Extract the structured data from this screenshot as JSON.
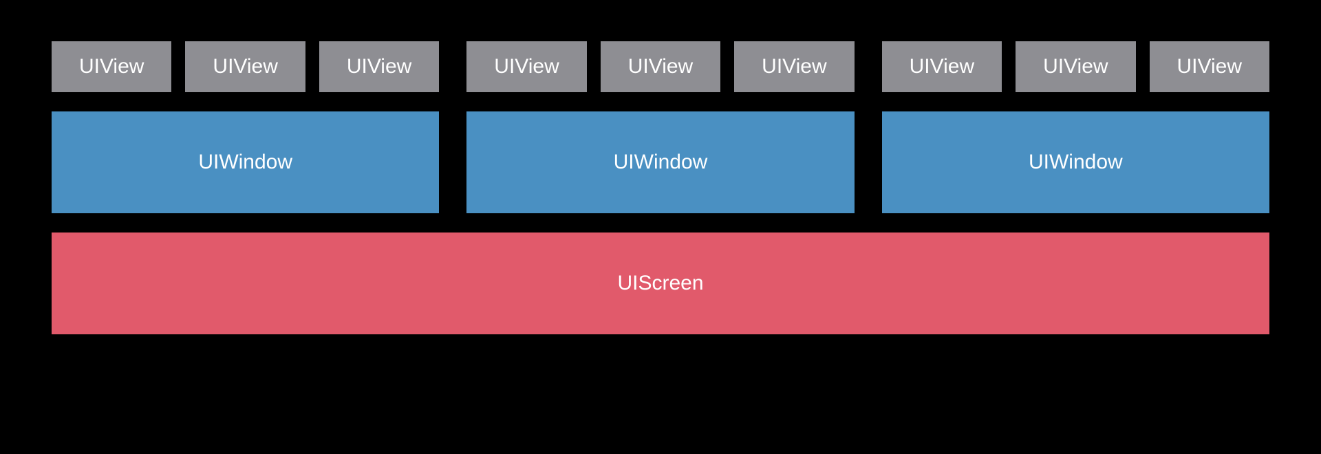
{
  "hierarchy": {
    "groups": [
      {
        "views": [
          "UIView",
          "UIView",
          "UIView"
        ],
        "window": "UIWindow"
      },
      {
        "views": [
          "UIView",
          "UIView",
          "UIView"
        ],
        "window": "UIWindow"
      },
      {
        "views": [
          "UIView",
          "UIView",
          "UIView"
        ],
        "window": "UIWindow"
      }
    ],
    "screen": "UIScreen"
  },
  "colors": {
    "view": "#8e8e93",
    "window": "#4a90c2",
    "screen": "#e15a6b",
    "background": "#000000",
    "text": "#ffffff"
  }
}
